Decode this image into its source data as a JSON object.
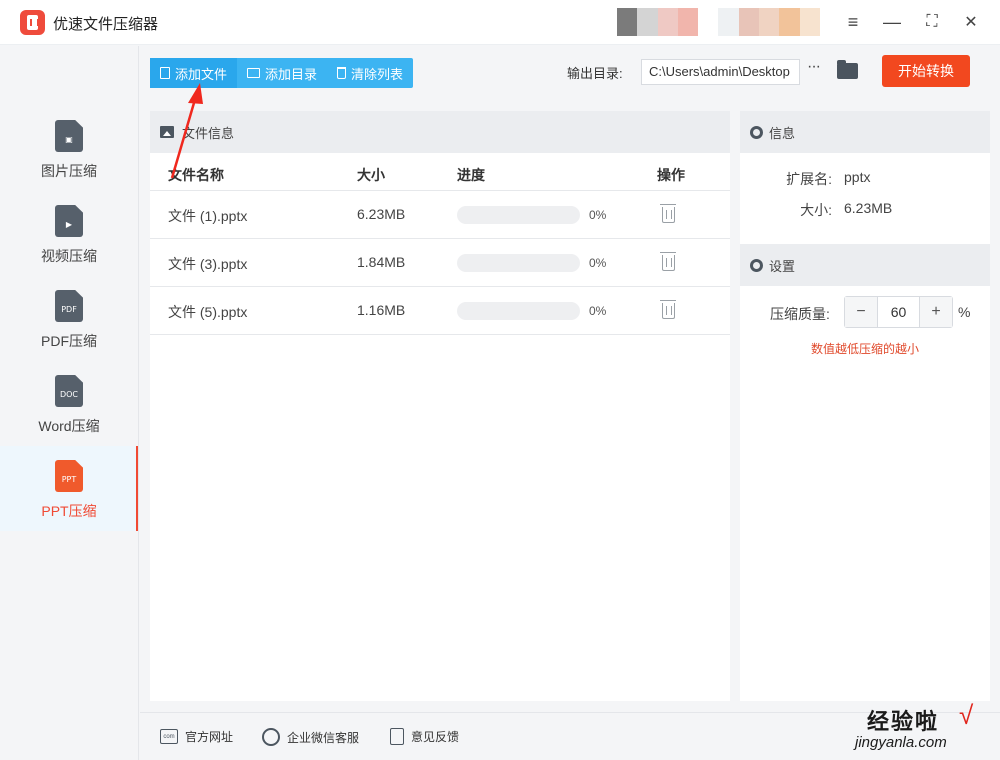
{
  "app": {
    "title": "优速文件压缩器"
  },
  "window": {
    "menu_icon": "≡",
    "min_icon": "—",
    "max_icon": "⛶",
    "close_icon": "✕"
  },
  "sidebar": {
    "items": [
      {
        "label": "图片压缩",
        "mark": "▣",
        "icon": "image-file-icon"
      },
      {
        "label": "视频压缩",
        "mark": "▶",
        "icon": "video-file-icon"
      },
      {
        "label": "PDF压缩",
        "mark": "PDF",
        "icon": "pdf-file-icon"
      },
      {
        "label": "Word压缩",
        "mark": "DOC",
        "icon": "doc-file-icon"
      },
      {
        "label": "PPT压缩",
        "mark": "PPT",
        "icon": "ppt-file-icon",
        "active": true
      }
    ]
  },
  "toolbar": {
    "add_file": "添加文件",
    "add_dir": "添加目录",
    "clear_list": "清除列表",
    "output_label": "输出目录:",
    "output_path": "C:\\Users\\admin\\Desktop",
    "more": "···",
    "start": "开始转换"
  },
  "file_panel": {
    "title": "文件信息",
    "columns": {
      "name": "文件名称",
      "size": "大小",
      "progress": "进度",
      "action": "操作"
    },
    "rows": [
      {
        "name": "文件 (1).pptx",
        "size": "6.23MB",
        "progress": 0,
        "progress_text": "0%"
      },
      {
        "name": "文件 (3).pptx",
        "size": "1.84MB",
        "progress": 0,
        "progress_text": "0%"
      },
      {
        "name": "文件 (5).pptx",
        "size": "1.16MB",
        "progress": 0,
        "progress_text": "0%"
      }
    ]
  },
  "info": {
    "title": "信息",
    "ext_label": "扩展名:",
    "ext_value": "pptx",
    "size_label": "大小:",
    "size_value": "6.23MB"
  },
  "settings": {
    "title": "设置",
    "quality_label": "压缩质量:",
    "minus": "−",
    "plus": "+",
    "quality_value": "60",
    "unit": "%",
    "hint": "数值越低压缩的越小"
  },
  "footer": {
    "website": "官方网址",
    "website_icon_text": "com",
    "wechat": "企业微信客服",
    "feedback": "意见反馈"
  },
  "watermark": {
    "text": "经验啦",
    "check": "√",
    "url": "jingyanla.com"
  },
  "colors": {
    "accent": "#2aa7ec",
    "start": "#f2481f",
    "active": "#f04a34",
    "hint": "#e04a2c"
  }
}
